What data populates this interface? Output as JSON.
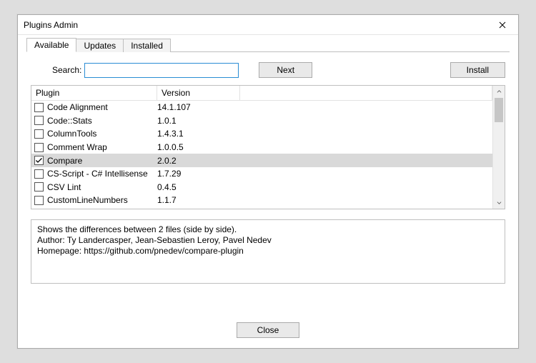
{
  "window": {
    "title": "Plugins Admin",
    "close_button_name": "close"
  },
  "tabs": [
    {
      "label": "Available",
      "active": true
    },
    {
      "label": "Updates",
      "active": false
    },
    {
      "label": "Installed",
      "active": false
    }
  ],
  "toolbar": {
    "search_label": "Search:",
    "search_value": "",
    "search_placeholder": "",
    "next_label": "Next",
    "install_label": "Install"
  },
  "list": {
    "columns": {
      "plugin": "Plugin",
      "version": "Version"
    },
    "rows": [
      {
        "name": "Code Alignment",
        "version": "14.1.107",
        "checked": false,
        "selected": false
      },
      {
        "name": "Code::Stats",
        "version": "1.0.1",
        "checked": false,
        "selected": false
      },
      {
        "name": "ColumnTools",
        "version": "1.4.3.1",
        "checked": false,
        "selected": false
      },
      {
        "name": "Comment Wrap",
        "version": "1.0.0.5",
        "checked": false,
        "selected": false
      },
      {
        "name": "Compare",
        "version": "2.0.2",
        "checked": true,
        "selected": true
      },
      {
        "name": "CS-Script - C# Intellisense",
        "version": "1.7.29",
        "checked": false,
        "selected": false
      },
      {
        "name": "CSV Lint",
        "version": "0.4.5",
        "checked": false,
        "selected": false
      },
      {
        "name": "CustomLineNumbers",
        "version": "1.1.7",
        "checked": false,
        "selected": false
      }
    ]
  },
  "description": {
    "line1": "Shows the differences between 2 files (side by side).",
    "line2": "Author: Ty Landercasper, Jean-Sebastien Leroy, Pavel Nedev",
    "line3": "Homepage: https://github.com/pnedev/compare-plugin"
  },
  "footer": {
    "close_label": "Close"
  }
}
